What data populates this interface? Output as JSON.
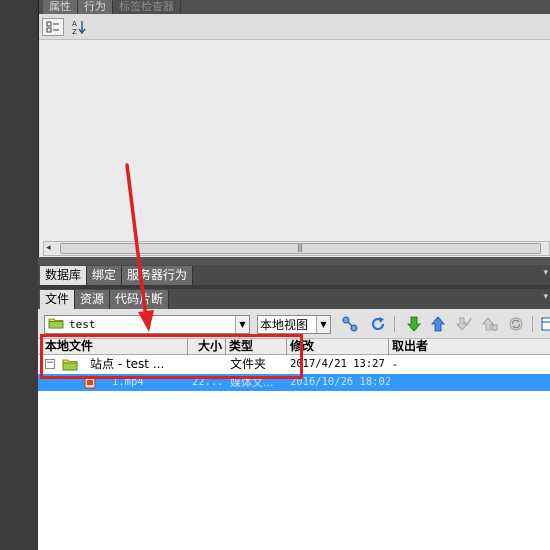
{
  "top_panel": {
    "tabs": [
      "属性",
      "行为",
      "标签检查器"
    ],
    "az_label": "A↓Z"
  },
  "db_panel": {
    "tabs": [
      "数据库",
      "绑定",
      "服务器行为"
    ]
  },
  "files_panel": {
    "tabs": [
      "文件",
      "资源",
      "代码片断"
    ],
    "site_select": "test",
    "view_select": "本地视图",
    "columns": [
      "本地文件",
      "大小",
      "类型",
      "修改",
      "取出者"
    ],
    "rows": [
      {
        "name": "站点 - test ...",
        "size": "",
        "type": "文件夹",
        "modified": "2017/4/21 13:27",
        "checked_out": "-"
      },
      {
        "name": "1.mp4",
        "size": "22...",
        "type": "媒体文...",
        "modified": "2016/10/26 18:02",
        "checked_out": ""
      }
    ]
  },
  "icons": {
    "connect": "connect-icon",
    "refresh": "refresh-icon",
    "get": "get-down-arrow-icon",
    "put": "put-up-arrow-icon",
    "checkout": "check-out-icon",
    "checkin": "check-in-icon",
    "sync": "sync-icon",
    "expand": "expand-icon"
  },
  "colors": {
    "annotation": "#e0201e",
    "selection": "#3399ff",
    "get_arrow": "#2e9a1e",
    "put_arrow": "#2f6fd6"
  }
}
